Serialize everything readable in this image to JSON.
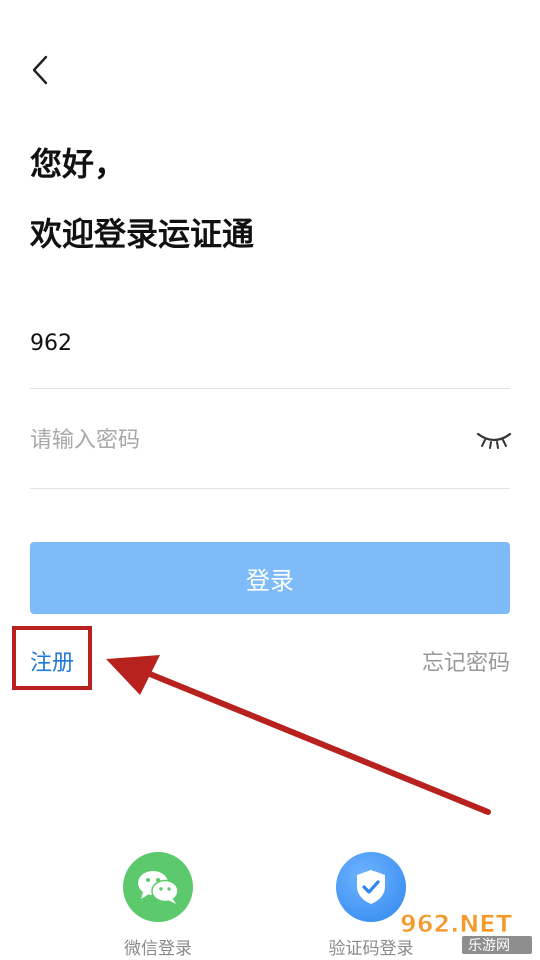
{
  "header": {
    "back_icon": "chevron-left-icon"
  },
  "greeting": {
    "line1": "您好，",
    "line2": "欢迎登录运证通"
  },
  "form": {
    "phone_value": "962",
    "password_placeholder": "请输入密码",
    "eye_icon": "eye-closed-icon"
  },
  "actions": {
    "login_label": "登录",
    "register_label": "注册",
    "forgot_label": "忘记密码"
  },
  "third_party": {
    "wechat_label": "微信登录",
    "wechat_icon": "wechat-icon",
    "sms_label": "验证码登录",
    "sms_icon": "shield-check-icon"
  },
  "watermark": {
    "brand": "962.NET",
    "sub": "乐游网"
  },
  "colors": {
    "primary_disabled": "#7fbaf9",
    "link": "#1f7ad8",
    "annotation_red": "#b8221e",
    "wechat_green": "#5cc96c",
    "sms_blue": "#2f86ee"
  }
}
